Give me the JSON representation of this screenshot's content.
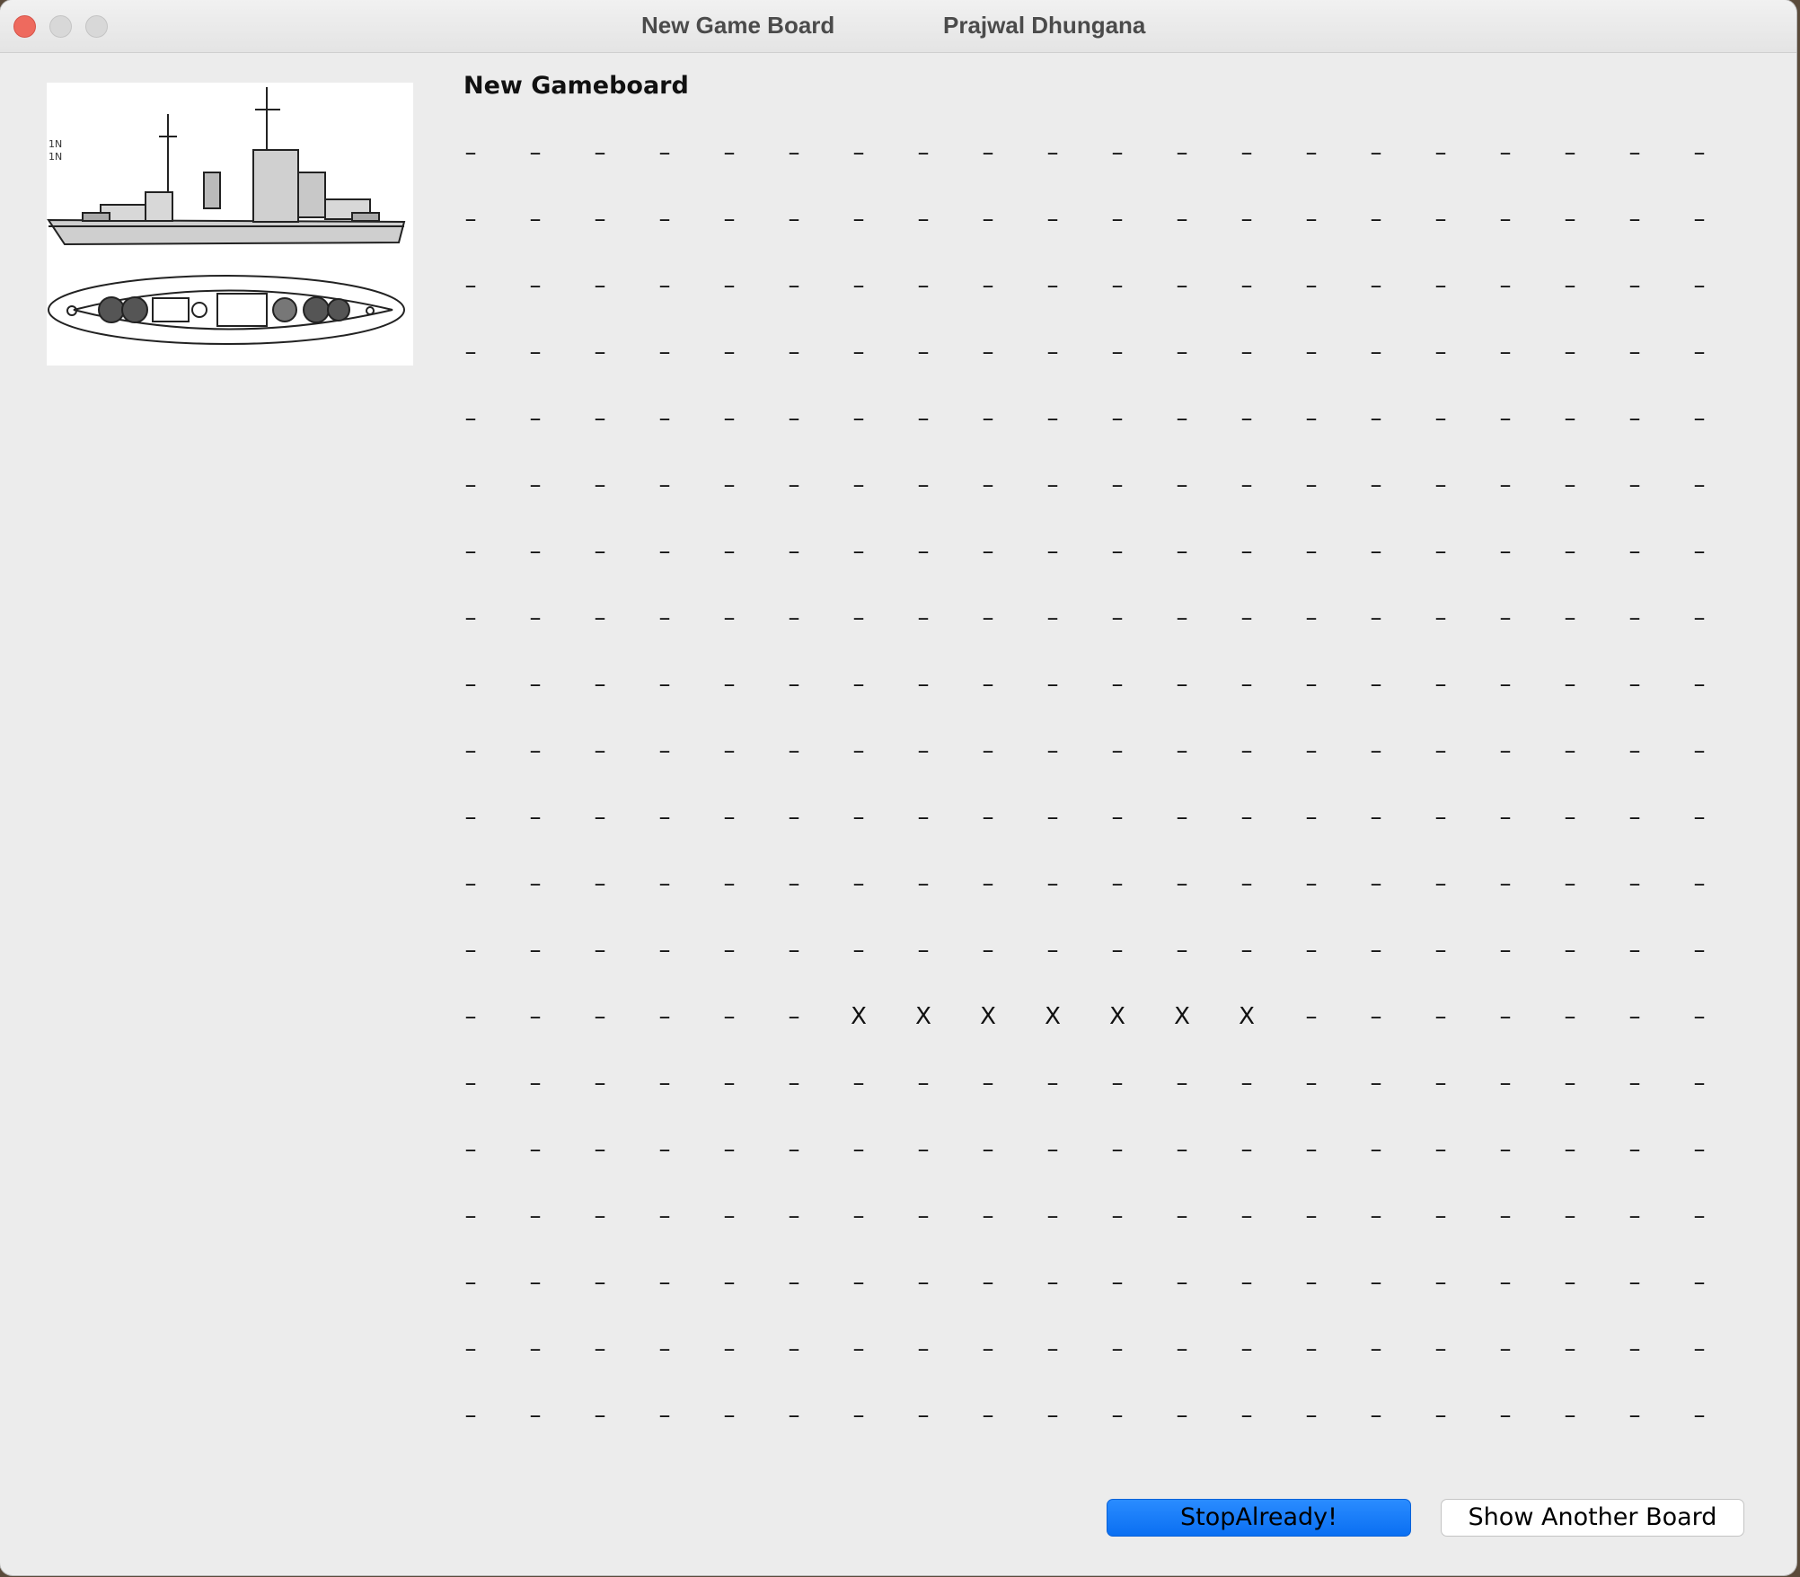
{
  "window": {
    "title": "New Game Board",
    "author": "Prajwal Dhungana"
  },
  "board": {
    "heading": "New Gameboard",
    "rows": [
      [
        "–",
        "–",
        "–",
        "–",
        "–",
        "–",
        "–",
        "–",
        "–",
        "–",
        "–",
        "–",
        "–",
        "–",
        "–",
        "–",
        "–",
        "–",
        "–",
        "–"
      ],
      [
        "–",
        "–",
        "–",
        "–",
        "–",
        "–",
        "–",
        "–",
        "–",
        "–",
        "–",
        "–",
        "–",
        "–",
        "–",
        "–",
        "–",
        "–",
        "–",
        "–"
      ],
      [
        "–",
        "–",
        "–",
        "–",
        "–",
        "–",
        "–",
        "–",
        "–",
        "–",
        "–",
        "–",
        "–",
        "–",
        "–",
        "–",
        "–",
        "–",
        "–",
        "–"
      ],
      [
        "–",
        "–",
        "–",
        "–",
        "–",
        "–",
        "–",
        "–",
        "–",
        "–",
        "–",
        "–",
        "–",
        "–",
        "–",
        "–",
        "–",
        "–",
        "–",
        "–"
      ],
      [
        "–",
        "–",
        "–",
        "–",
        "–",
        "–",
        "–",
        "–",
        "–",
        "–",
        "–",
        "–",
        "–",
        "–",
        "–",
        "–",
        "–",
        "–",
        "–",
        "–"
      ],
      [
        "–",
        "–",
        "–",
        "–",
        "–",
        "–",
        "–",
        "–",
        "–",
        "–",
        "–",
        "–",
        "–",
        "–",
        "–",
        "–",
        "–",
        "–",
        "–",
        "–"
      ],
      [
        "–",
        "–",
        "–",
        "–",
        "–",
        "–",
        "–",
        "–",
        "–",
        "–",
        "–",
        "–",
        "–",
        "–",
        "–",
        "–",
        "–",
        "–",
        "–",
        "–"
      ],
      [
        "–",
        "–",
        "–",
        "–",
        "–",
        "–",
        "–",
        "–",
        "–",
        "–",
        "–",
        "–",
        "–",
        "–",
        "–",
        "–",
        "–",
        "–",
        "–",
        "–"
      ],
      [
        "–",
        "–",
        "–",
        "–",
        "–",
        "–",
        "–",
        "–",
        "–",
        "–",
        "–",
        "–",
        "–",
        "–",
        "–",
        "–",
        "–",
        "–",
        "–",
        "–"
      ],
      [
        "–",
        "–",
        "–",
        "–",
        "–",
        "–",
        "–",
        "–",
        "–",
        "–",
        "–",
        "–",
        "–",
        "–",
        "–",
        "–",
        "–",
        "–",
        "–",
        "–"
      ],
      [
        "–",
        "–",
        "–",
        "–",
        "–",
        "–",
        "–",
        "–",
        "–",
        "–",
        "–",
        "–",
        "–",
        "–",
        "–",
        "–",
        "–",
        "–",
        "–",
        "–"
      ],
      [
        "–",
        "–",
        "–",
        "–",
        "–",
        "–",
        "–",
        "–",
        "–",
        "–",
        "–",
        "–",
        "–",
        "–",
        "–",
        "–",
        "–",
        "–",
        "–",
        "–"
      ],
      [
        "–",
        "–",
        "–",
        "–",
        "–",
        "–",
        "–",
        "–",
        "–",
        "–",
        "–",
        "–",
        "–",
        "–",
        "–",
        "–",
        "–",
        "–",
        "–",
        "–"
      ],
      [
        "–",
        "–",
        "–",
        "–",
        "–",
        "–",
        "X",
        "X",
        "X",
        "X",
        "X",
        "X",
        "X",
        "–",
        "–",
        "–",
        "–",
        "–",
        "–",
        "–"
      ],
      [
        "–",
        "–",
        "–",
        "–",
        "–",
        "–",
        "–",
        "–",
        "–",
        "–",
        "–",
        "–",
        "–",
        "–",
        "–",
        "–",
        "–",
        "–",
        "–",
        "–"
      ],
      [
        "–",
        "–",
        "–",
        "–",
        "–",
        "–",
        "–",
        "–",
        "–",
        "–",
        "–",
        "–",
        "–",
        "–",
        "–",
        "–",
        "–",
        "–",
        "–",
        "–"
      ],
      [
        "–",
        "–",
        "–",
        "–",
        "–",
        "–",
        "–",
        "–",
        "–",
        "–",
        "–",
        "–",
        "–",
        "–",
        "–",
        "–",
        "–",
        "–",
        "–",
        "–"
      ],
      [
        "–",
        "–",
        "–",
        "–",
        "–",
        "–",
        "–",
        "–",
        "–",
        "–",
        "–",
        "–",
        "–",
        "–",
        "–",
        "–",
        "–",
        "–",
        "–",
        "–"
      ],
      [
        "–",
        "–",
        "–",
        "–",
        "–",
        "–",
        "–",
        "–",
        "–",
        "–",
        "–",
        "–",
        "–",
        "–",
        "–",
        "–",
        "–",
        "–",
        "–",
        "–"
      ],
      [
        "–",
        "–",
        "–",
        "–",
        "–",
        "–",
        "–",
        "–",
        "–",
        "–",
        "–",
        "–",
        "–",
        "–",
        "–",
        "–",
        "–",
        "–",
        "–",
        "–"
      ]
    ]
  },
  "image": {
    "icon": "battleship-blueprint-icon"
  },
  "buttons": {
    "stop_label": "StopAlready!",
    "another_label": "Show Another Board"
  },
  "colors": {
    "primary_button": "#0a6ff2",
    "close_button": "#ee6a5e"
  }
}
